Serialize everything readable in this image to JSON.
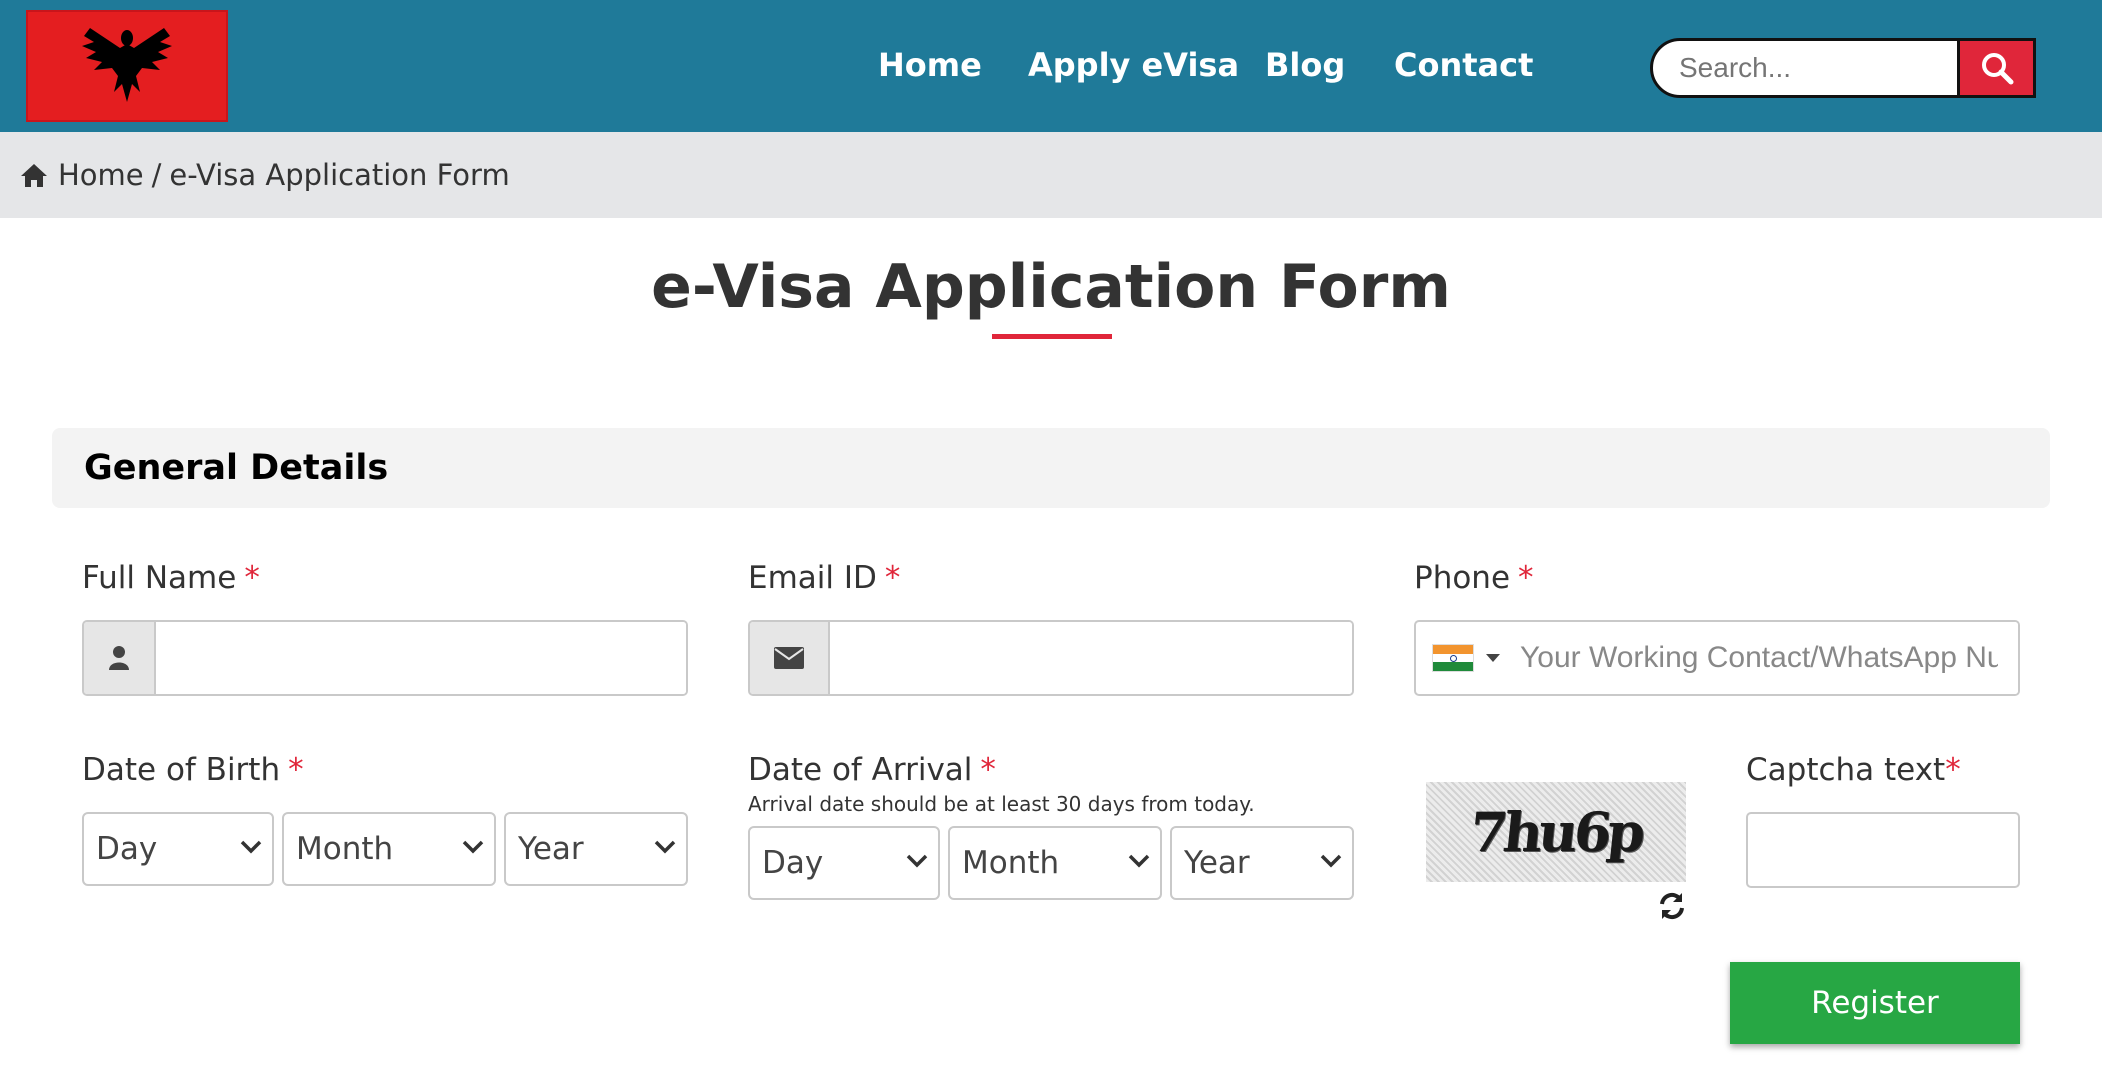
{
  "header": {
    "nav": [
      {
        "label": "Home"
      },
      {
        "label": "Apply eVisa"
      },
      {
        "label": "Blog"
      },
      {
        "label": "Contact"
      }
    ],
    "search_placeholder": "Search..."
  },
  "breadcrumb": {
    "home": "Home",
    "separator": "/",
    "current": "e-Visa Application Form"
  },
  "page_title": "e-Visa Application Form",
  "section": {
    "title": "General Details"
  },
  "form": {
    "full_name_label": "Full Name",
    "email_label": "Email ID",
    "phone_label": "Phone",
    "phone_placeholder": "Your Working Contact/WhatsApp Number",
    "required_mark": "*",
    "dob_label": "Date of Birth",
    "doa_label": "Date of Arrival",
    "doa_hint": "Arrival date should be at least 30 days from today.",
    "captcha_label": "Captcha text",
    "captcha_code": "7hu6p",
    "day": "Day",
    "month": "Month",
    "year": "Year",
    "register_label": "Register"
  },
  "colors": {
    "header_bg": "#1f7a99",
    "accent_red": "#e0263a",
    "register_green": "#27a744"
  },
  "icons": {
    "search": "search-icon",
    "home": "home-icon",
    "user": "user-icon",
    "envelope": "envelope-icon",
    "refresh": "refresh-icon",
    "flag": "india-flag-icon"
  }
}
